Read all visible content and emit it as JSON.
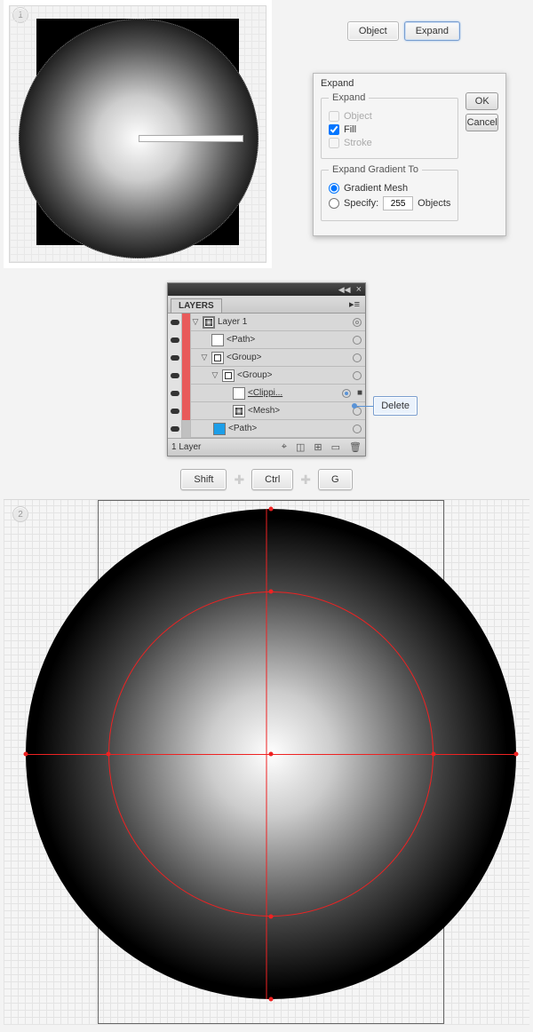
{
  "step1": "1",
  "step2": "2",
  "menu": {
    "object": "Object",
    "expand": "Expand"
  },
  "dialog": {
    "title": "Expand",
    "grp1": "Expand",
    "opt_object": "Object",
    "opt_fill": "Fill",
    "opt_stroke": "Stroke",
    "grp2": "Expand Gradient To",
    "opt_mesh": "Gradient Mesh",
    "opt_specify": "Specify:",
    "specify_val": "255",
    "specify_unit": "Objects",
    "ok": "OK",
    "cancel": "Cancel"
  },
  "layers": {
    "tab": "LAYERS",
    "row0": "Layer 1",
    "row1": "<Path>",
    "row2": "<Group>",
    "row3": "<Group>",
    "row4": "<Clippi...",
    "row5": "<Mesh>",
    "row6": "<Path>",
    "footer": "1 Layer"
  },
  "tooltip": {
    "delete": "Delete"
  },
  "kbd": {
    "shift": "Shift",
    "ctrl": "Ctrl",
    "g": "G"
  }
}
